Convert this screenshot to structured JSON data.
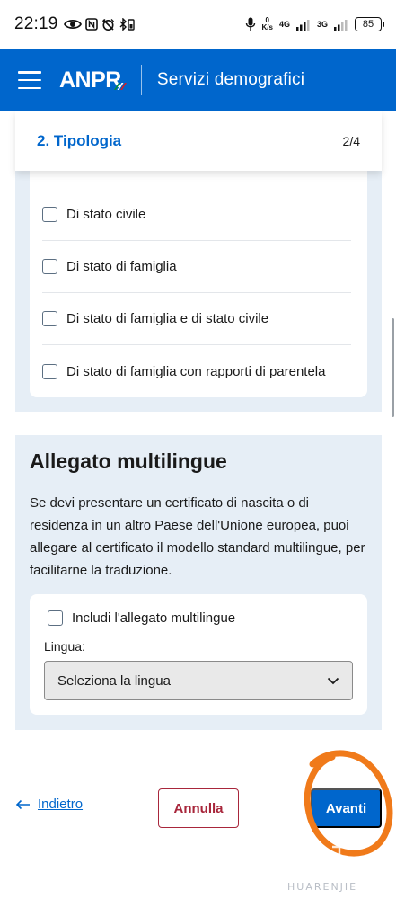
{
  "status_bar": {
    "time": "22:19",
    "net_speed_value": "0",
    "net_speed_unit": "K/s",
    "signal_1": "4G",
    "signal_2": "3G",
    "battery": "85"
  },
  "header": {
    "logo": "ANPR",
    "title": "Servizi demografici",
    "brand_color": "#0066cc"
  },
  "step": {
    "title": "2. Tipologia",
    "count": "2/4"
  },
  "tipologia_options": [
    {
      "label": "Di stato civile",
      "checked": false
    },
    {
      "label": "Di stato di famiglia",
      "checked": false
    },
    {
      "label": "Di stato di famiglia e di stato civile",
      "checked": false
    },
    {
      "label": "Di stato di famiglia con rapporti di parentela",
      "checked": false
    }
  ],
  "multilingue": {
    "title": "Allegato multilingue",
    "description": "Se devi presentare un certificato di nascita o di residenza in un altro Paese dell'Unione europea, puoi allegare al certificato il modello standard multilingue, per facilitarne la traduzione.",
    "checkbox_label": "Includi l'allegato multilingue",
    "lingua_label": "Lingua:",
    "select_value": "Seleziona la lingua"
  },
  "navigation": {
    "back_label": "Indietro",
    "cancel_label": "Annulla",
    "next_label": "Avanti"
  },
  "watermark": {
    "text": "HUARENJIE"
  },
  "colors": {
    "primary": "#0066cc",
    "danger": "#a8263b",
    "panel_bg": "#e6eef6",
    "annotation": "#f07a1a"
  }
}
